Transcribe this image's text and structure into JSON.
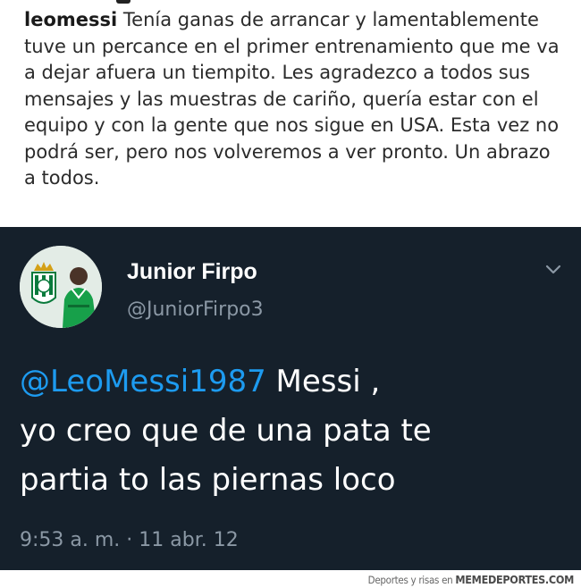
{
  "instagram_post": {
    "username": "leomessi",
    "caption": "Tenía ganas de arrancar y lamentablemente tuve un percance en el primer entrenamiento que me va a dejar afuera un tiempito. Les agradezco a todos sus mensajes y las muestras de cariño, quería estar con el equipo y con la gente que nos sigue en USA. Esta vez no podrá ser, pero nos volveremos a ver pronto. Un abrazo a todos."
  },
  "tweet": {
    "display_name": "Junior Firpo",
    "handle": "@JuniorFirpo3",
    "mention": "@LeoMessi1987",
    "text_line1": " Messi ,",
    "text_line2": "yo creo que de una pata te",
    "text_line3": "partia to las piernas loco",
    "timestamp": "9:53 a. m. · 11 abr. 12",
    "avatar_icon": "profile-photo",
    "menu_icon": "chevron-down-icon",
    "colors": {
      "background": "#15202b",
      "mention": "#1d9bf0",
      "secondary_text": "#8b98a5"
    }
  },
  "watermark": {
    "prefix": "Deportes y risas en ",
    "brand": "MEMEDEPORTES.COM"
  }
}
